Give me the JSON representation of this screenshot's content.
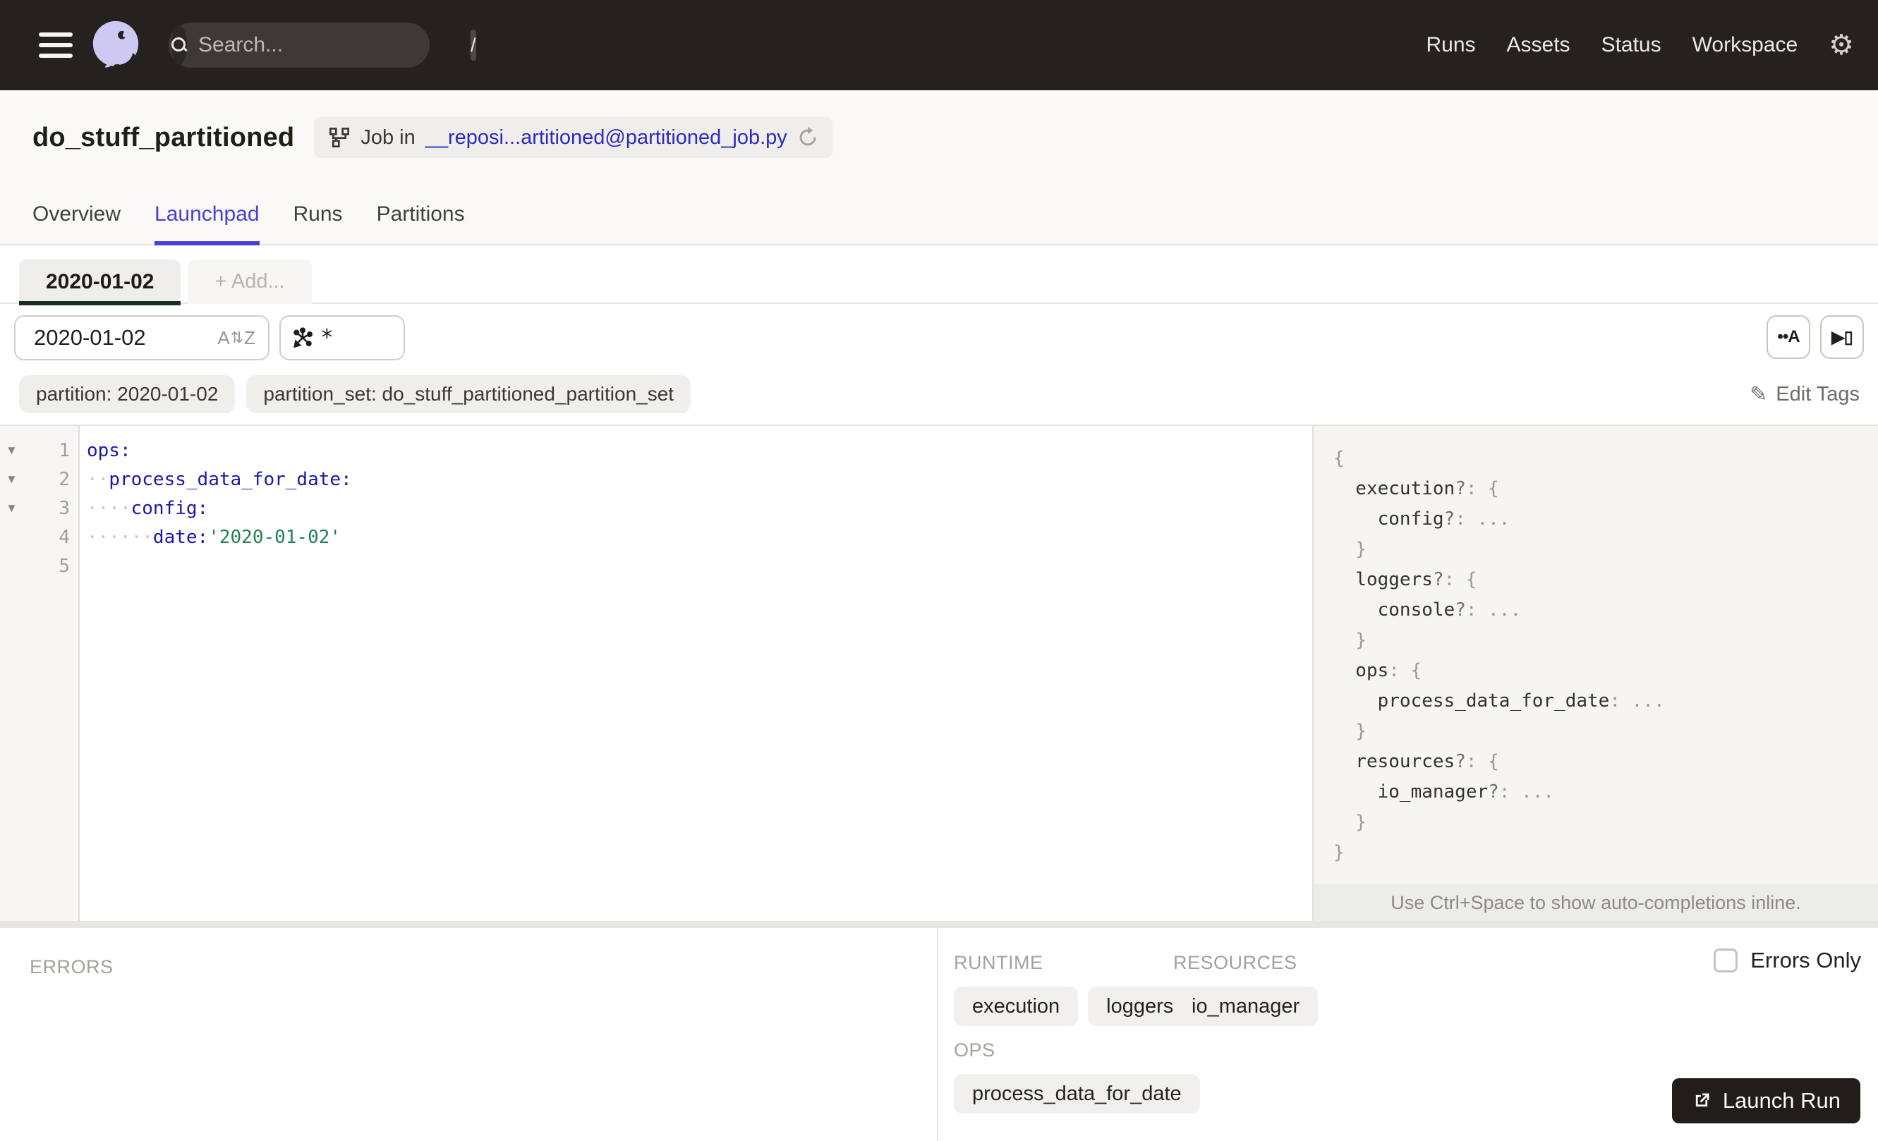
{
  "colors": {
    "accent": "#4741d6",
    "link": "#2d2abf",
    "nav_bg": "#25211e",
    "yaml_key": "#1a19a7",
    "yaml_string": "#1f8150",
    "partition_tab_underline": "#16301f",
    "launch_bg": "#211e1a"
  },
  "nav": {
    "search_placeholder": "Search...",
    "search_shortcut": "/",
    "links": [
      "Runs",
      "Assets",
      "Status",
      "Workspace"
    ]
  },
  "header": {
    "title": "do_stuff_partitioned",
    "badge_prefix": "Job in",
    "badge_link": "__reposi...artitioned@partitioned_job.py"
  },
  "tabs": [
    {
      "label": "Overview",
      "active": false
    },
    {
      "label": "Launchpad",
      "active": true
    },
    {
      "label": "Runs",
      "active": false
    },
    {
      "label": "Partitions",
      "active": false
    }
  ],
  "launchpad": {
    "partition_tabs": [
      {
        "label": "2020-01-02",
        "active": true
      },
      {
        "label": "+ Add...",
        "active": false
      }
    ],
    "partition_input": "2020-01-02",
    "op_selector": "*",
    "toolbar": {
      "whitespace_button": "••A",
      "scaffold_button": "▶▯"
    },
    "tags": [
      "partition: 2020-01-02",
      "partition_set: do_stuff_partitioned_partition_set"
    ],
    "edit_tags": "Edit Tags"
  },
  "editor": {
    "lines": [
      {
        "num": "1",
        "fold": true,
        "indent": 0,
        "key": "ops:",
        "value": ""
      },
      {
        "num": "2",
        "fold": true,
        "indent": 2,
        "key": "process_data_for_date:",
        "value": ""
      },
      {
        "num": "3",
        "fold": true,
        "indent": 4,
        "key": "config:",
        "value": ""
      },
      {
        "num": "4",
        "fold": false,
        "indent": 6,
        "key": "date:",
        "value": "'2020-01-02'"
      },
      {
        "num": "5",
        "fold": false,
        "indent": 0,
        "key": "",
        "value": ""
      }
    ]
  },
  "schema": {
    "lines": [
      {
        "indent": 0,
        "key": "",
        "opt": "",
        "punct": "{"
      },
      {
        "indent": 1,
        "key": "execution",
        "opt": "?",
        "punct": ": {"
      },
      {
        "indent": 2,
        "key": "config",
        "opt": "?",
        "punct": ": ..."
      },
      {
        "indent": 1,
        "key": "",
        "opt": "",
        "punct": "}"
      },
      {
        "indent": 1,
        "key": "loggers",
        "opt": "?",
        "punct": ": {"
      },
      {
        "indent": 2,
        "key": "console",
        "opt": "?",
        "punct": ": ..."
      },
      {
        "indent": 1,
        "key": "",
        "opt": "",
        "punct": "}"
      },
      {
        "indent": 1,
        "key": "ops",
        "opt": "",
        "punct": ": {"
      },
      {
        "indent": 2,
        "key": "process_data_for_date",
        "opt": "",
        "punct": ": ..."
      },
      {
        "indent": 1,
        "key": "",
        "opt": "",
        "punct": "}"
      },
      {
        "indent": 1,
        "key": "resources",
        "opt": "?",
        "punct": ": {"
      },
      {
        "indent": 2,
        "key": "io_manager",
        "opt": "?",
        "punct": ": ..."
      },
      {
        "indent": 1,
        "key": "",
        "opt": "",
        "punct": "}"
      },
      {
        "indent": 0,
        "key": "",
        "opt": "",
        "punct": "}"
      }
    ],
    "hint": "Use Ctrl+Space to show auto-completions inline."
  },
  "bottom": {
    "errors_label": "ERRORS",
    "runtime_label": "RUNTIME",
    "runtime_chips": [
      "execution",
      "loggers"
    ],
    "resources_label": "RESOURCES",
    "resources_chips": [
      "io_manager"
    ],
    "ops_label": "OPS",
    "ops_chips": [
      "process_data_for_date"
    ],
    "errors_only_label": "Errors Only",
    "launch_button": "Launch Run"
  }
}
